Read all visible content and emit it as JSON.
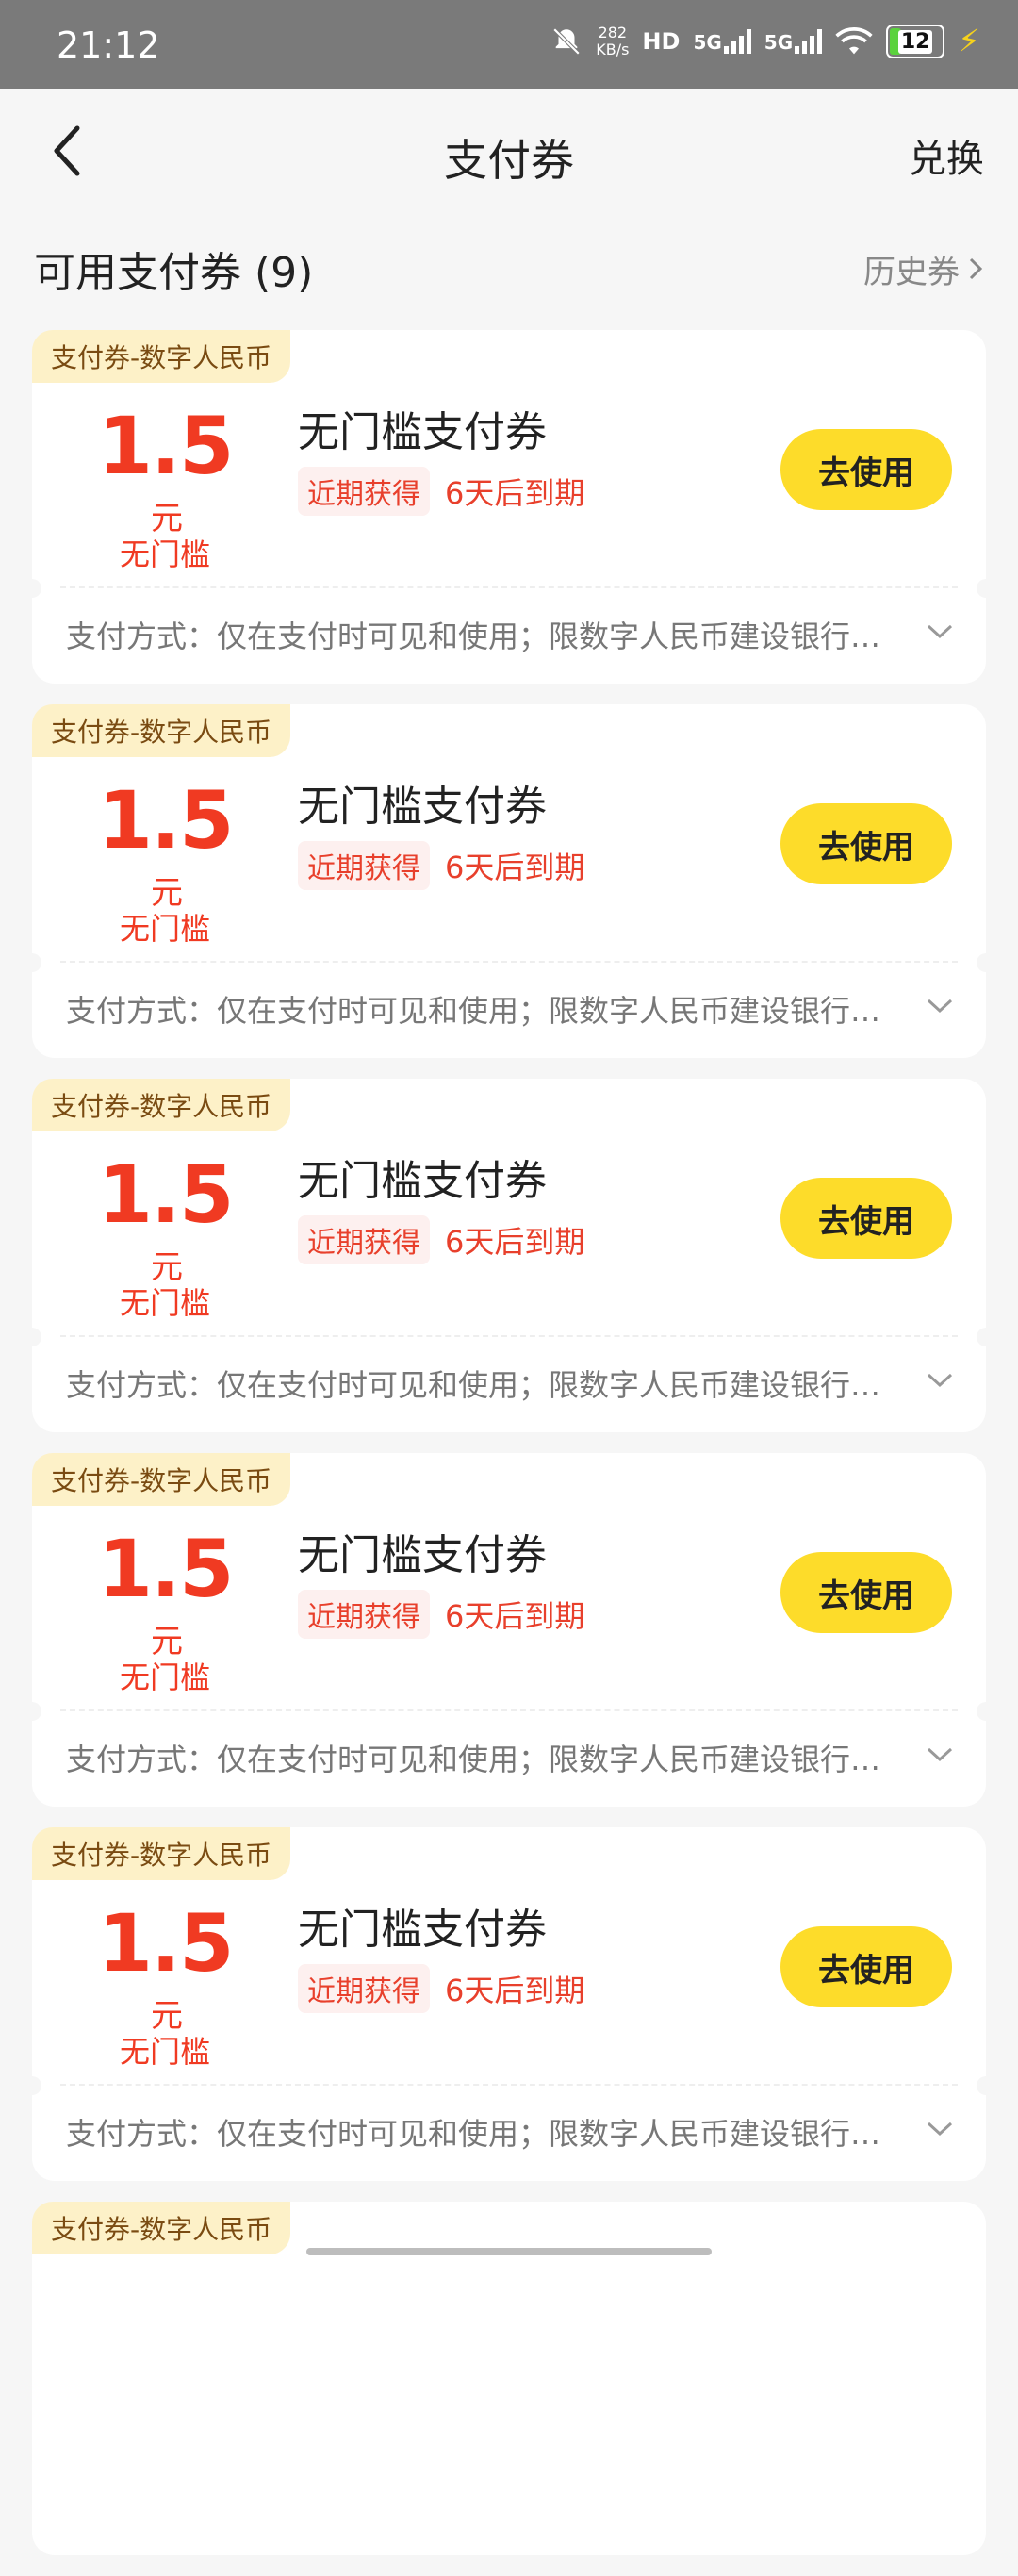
{
  "status_bar": {
    "time": "21:12",
    "net_speed_value": "282",
    "net_speed_unit": "KB/s",
    "hd": "HD",
    "sig1": "5G",
    "sig2": "5G",
    "battery": "12",
    "icons": [
      "mute-bell-icon",
      "hd-icon",
      "signal-icon",
      "signal-icon",
      "wifi-icon",
      "battery-icon",
      "charging-icon"
    ]
  },
  "header": {
    "title": "支付券",
    "right_action": "兑换"
  },
  "section": {
    "title": "可用支付券 (9)",
    "history": "历史券"
  },
  "coupons": [
    {
      "tag": "支付券-数字人民币",
      "amount": "1.5",
      "unit": "元",
      "condition": "无门槛",
      "name": "无门槛支付券",
      "chip": "近期获得",
      "expiry": "6天后到期",
      "button": "去使用",
      "desc": "支付方式：仅在支付时可见和使用；限数字人民币建设银行钱包使用"
    },
    {
      "tag": "支付券-数字人民币",
      "amount": "1.5",
      "unit": "元",
      "condition": "无门槛",
      "name": "无门槛支付券",
      "chip": "近期获得",
      "expiry": "6天后到期",
      "button": "去使用",
      "desc": "支付方式：仅在支付时可见和使用；限数字人民币建设银行钱包使用"
    },
    {
      "tag": "支付券-数字人民币",
      "amount": "1.5",
      "unit": "元",
      "condition": "无门槛",
      "name": "无门槛支付券",
      "chip": "近期获得",
      "expiry": "6天后到期",
      "button": "去使用",
      "desc": "支付方式：仅在支付时可见和使用；限数字人民币建设银行钱包使用"
    },
    {
      "tag": "支付券-数字人民币",
      "amount": "1.5",
      "unit": "元",
      "condition": "无门槛",
      "name": "无门槛支付券",
      "chip": "近期获得",
      "expiry": "6天后到期",
      "button": "去使用",
      "desc": "支付方式：仅在支付时可见和使用；限数字人民币建设银行钱包使用"
    },
    {
      "tag": "支付券-数字人民币",
      "amount": "1.5",
      "unit": "元",
      "condition": "无门槛",
      "name": "无门槛支付券",
      "chip": "近期获得",
      "expiry": "6天后到期",
      "button": "去使用",
      "desc": "支付方式：仅在支付时可见和使用；限数字人民币建设银行钱包使用"
    },
    {
      "tag": "支付券-数字人民币"
    }
  ],
  "colors": {
    "accent_red": "#f03a22",
    "button_yellow": "#fddc2a",
    "tag_bg": "#fdf1c8"
  }
}
